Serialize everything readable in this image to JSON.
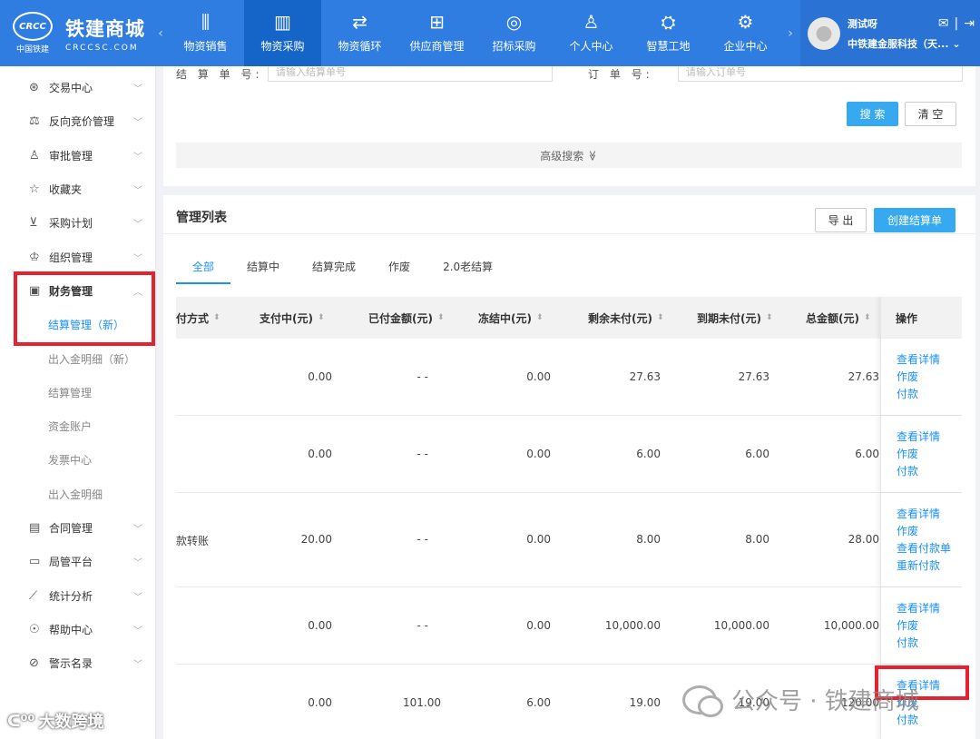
{
  "header": {
    "logo": {
      "brand": "CRCC",
      "org": "中国铁建",
      "title": "铁建商城",
      "domain": "CRCCSC.COM"
    },
    "nav": [
      {
        "label": "物资销售",
        "icon": "bar-chart-icon",
        "glyph": "⫼"
      },
      {
        "label": "物资采购",
        "icon": "purchase-icon",
        "glyph": "▥",
        "active": true
      },
      {
        "label": "物资循环",
        "icon": "cycle-icon",
        "glyph": "⇄"
      },
      {
        "label": "供应商管理",
        "icon": "grid-icon",
        "glyph": "⊞"
      },
      {
        "label": "招标采购",
        "icon": "target-icon",
        "glyph": "◎"
      },
      {
        "label": "个人中心",
        "icon": "person-icon",
        "glyph": "♙"
      },
      {
        "label": "智慧工地",
        "icon": "site-icon",
        "glyph": "⛭"
      },
      {
        "label": "企业中心",
        "icon": "gear-icon",
        "glyph": "⚙"
      }
    ],
    "user": {
      "name": "测试呀",
      "company": "中铁建金服科技（天...",
      "avatar_glyph": "●"
    }
  },
  "sidebar": {
    "items": [
      {
        "label": "交易中心",
        "icon": "trade-icon",
        "glyph": "⊛"
      },
      {
        "label": "反向竞价管理",
        "icon": "auction-icon",
        "glyph": "⚖"
      },
      {
        "label": "审批管理",
        "icon": "approval-icon",
        "glyph": "♙"
      },
      {
        "label": "收藏夹",
        "icon": "star-icon",
        "glyph": "☆"
      },
      {
        "label": "采购计划",
        "icon": "cart-icon",
        "glyph": "⊻"
      },
      {
        "label": "组织管理",
        "icon": "org-icon",
        "glyph": "♔"
      },
      {
        "label": "财务管理",
        "icon": "finance-icon",
        "glyph": "▣",
        "open": true
      }
    ],
    "finance_sub": [
      {
        "label": "结算管理（新）",
        "active": true
      },
      {
        "label": "出入金明细（新）"
      },
      {
        "label": "结算管理"
      },
      {
        "label": "资金账户"
      },
      {
        "label": "发票中心"
      },
      {
        "label": "出入金明细"
      }
    ],
    "items_after": [
      {
        "label": "合同管理",
        "icon": "contract-icon",
        "glyph": "▤"
      },
      {
        "label": "局管平台",
        "icon": "monitor-icon",
        "glyph": "▭"
      },
      {
        "label": "统计分析",
        "icon": "chart-icon",
        "glyph": "⟋"
      },
      {
        "label": "帮助中心",
        "icon": "help-icon",
        "glyph": "☉"
      },
      {
        "label": "警示名录",
        "icon": "ban-icon",
        "glyph": "⊘"
      }
    ]
  },
  "search": {
    "settlement_no_label": "结 算 单 号:",
    "settlement_no_placeholder": "请输入结算单号",
    "order_no_label": "订   单   号:",
    "order_no_placeholder": "请输入订单号",
    "search_btn": "搜 索",
    "clear_btn": "清 空",
    "advanced": "高级搜索",
    "advanced_icon": "≫"
  },
  "list": {
    "title": "管理列表",
    "export_btn": "导 出",
    "create_btn": "创建结算单",
    "tabs": [
      "全部",
      "结算中",
      "结算完成",
      "作废",
      "2.0老结算"
    ],
    "active_tab": 0,
    "columns": {
      "pay_method": "付方式",
      "paying": "支付中(元)",
      "paid": "已付金额(元)",
      "frozen": "冻结中(元)",
      "remaining": "剩余未付(元)",
      "due": "到期未付(元)",
      "total": "总金额(元)",
      "op": "操作"
    },
    "sort_glyph": "⬍",
    "rows": [
      {
        "pay_method": "",
        "paying": "0.00",
        "paid": "- -",
        "frozen": "0.00",
        "remaining": "27.63",
        "due": "27.63",
        "total": "27.63",
        "ops": [
          "查看详情",
          "作废",
          "付款"
        ]
      },
      {
        "pay_method": "",
        "paying": "0.00",
        "paid": "- -",
        "frozen": "0.00",
        "remaining": "6.00",
        "due": "6.00",
        "total": "6.00",
        "ops": [
          "查看详情",
          "作废",
          "付款"
        ]
      },
      {
        "pay_method": "款转账",
        "paying": "20.00",
        "paid": "- -",
        "frozen": "0.00",
        "remaining": "8.00",
        "due": "8.00",
        "total": "28.00",
        "ops": [
          "查看详情",
          "作废",
          "查看付款单",
          "重新付款"
        ]
      },
      {
        "pay_method": "",
        "paying": "0.00",
        "paid": "- -",
        "frozen": "0.00",
        "remaining": "10,000.00",
        "due": "10,000.00",
        "total": "10,000.00",
        "ops": [
          "查看详情",
          "作废",
          "付款"
        ]
      },
      {
        "pay_method": "",
        "paying": "0.00",
        "paid": "101.00",
        "frozen": "6.00",
        "remaining": "19.00",
        "due": "19.00",
        "total": "120.00",
        "ops": [
          "查看详情",
          "作废",
          "付款"
        ]
      }
    ]
  },
  "watermarks": {
    "left": "大数跨境",
    "right": "公众号 · 铁建商城"
  }
}
